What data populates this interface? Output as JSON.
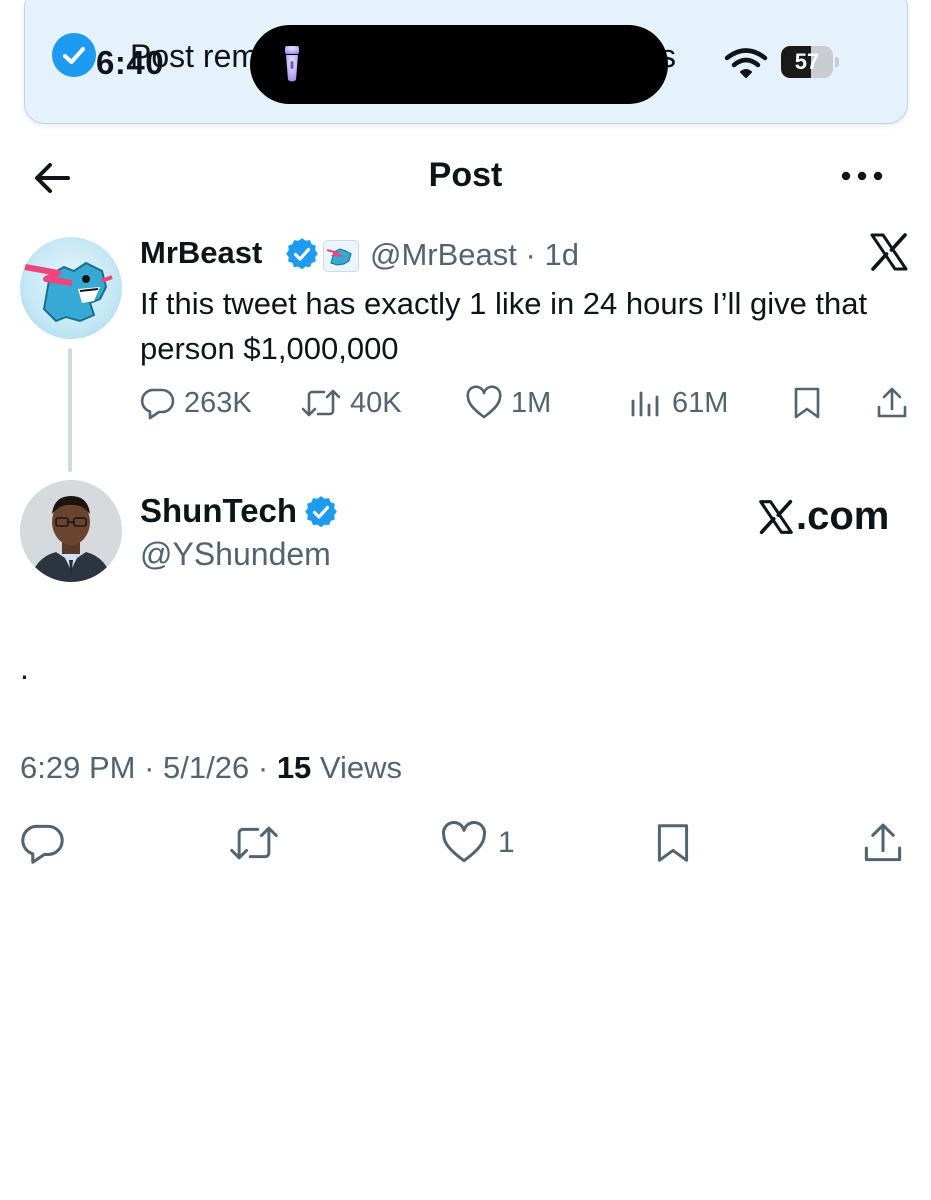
{
  "status_bar": {
    "time": "6:40",
    "battery": "57",
    "battery_level": 0.57
  },
  "toast": {
    "text": "Post rem",
    "text_right": "s"
  },
  "header": {
    "title": "Post"
  },
  "quoted_tweet": {
    "author_name": "MrBeast",
    "handle": "@MrBeast",
    "separator": "·",
    "age": "1d",
    "text": "If this tweet has exactly 1 like in 24 hours I’ll give that person $1,000,000",
    "replies": "263K",
    "reposts": "40K",
    "likes": "1M",
    "views": "61M"
  },
  "main_tweet": {
    "author_name": "ShunTech",
    "handle": "@YShundem",
    "watermark": ".com",
    "body": ".",
    "time": "6:29 PM",
    "date": "5/1/26",
    "views_count": "15",
    "views_label": "Views",
    "likes": "1"
  },
  "colors": {
    "accent": "#1d9bf0",
    "text": "#0f1419",
    "muted": "#536471",
    "toast_bg": "#e6f2fb"
  }
}
